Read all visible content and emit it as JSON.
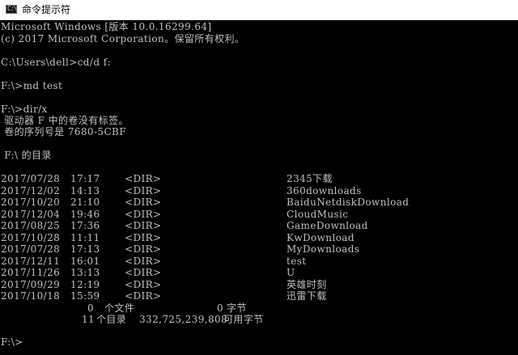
{
  "window": {
    "title": "命令提示符",
    "icon_label": "C:\\",
    "icon": "cmd-icon"
  },
  "console": {
    "header": {
      "line1": "Microsoft Windows [版本 10.0.16299.64]",
      "line2": "(c) 2017 Microsoft Corporation。保留所有权利。"
    },
    "commands": {
      "cd": "C:\\Users\\dell>cd/d f:",
      "md": "F:\\>md test",
      "dir": "F:\\>dir/x"
    },
    "volume": {
      "label_line": " 驱动器 F 中的卷没有标签。",
      "serial_line": " 卷的序列号是 7680-5CBF",
      "directory_of": " F:\\ 的目录"
    },
    "entries": [
      {
        "date": "2017/07/28",
        "time": "17:17",
        "type": "<DIR>",
        "name": "2345下载"
      },
      {
        "date": "2017/12/02",
        "time": "14:13",
        "type": "<DIR>",
        "name": "360downloads"
      },
      {
        "date": "2017/10/20",
        "time": "21:10",
        "type": "<DIR>",
        "name": "BaiduNetdiskDownload"
      },
      {
        "date": "2017/12/04",
        "time": "19:46",
        "type": "<DIR>",
        "name": "CloudMusic"
      },
      {
        "date": "2017/08/25",
        "time": "17:36",
        "type": "<DIR>",
        "name": "GameDownload"
      },
      {
        "date": "2017/10/28",
        "time": "11:11",
        "type": "<DIR>",
        "name": "KwDownload"
      },
      {
        "date": "2017/07/28",
        "time": "17:13",
        "type": "<DIR>",
        "name": "MyDownloads"
      },
      {
        "date": "2017/12/11",
        "time": "16:01",
        "type": "<DIR>",
        "name": "test"
      },
      {
        "date": "2017/11/26",
        "time": "13:13",
        "type": "<DIR>",
        "name": "U"
      },
      {
        "date": "2017/09/29",
        "time": "12:19",
        "type": "<DIR>",
        "name": "英雄时刻"
      },
      {
        "date": "2017/10/18",
        "time": "15:59",
        "type": "<DIR>",
        "name": "迅雷下载"
      }
    ],
    "summary": {
      "files_count": "0",
      "files_label": "个文件",
      "files_bytes": "0",
      "files_bytes_label": "字节",
      "dirs_count": "11",
      "dirs_label": "个目录",
      "dirs_free": "332,725,239,808",
      "dirs_free_label": "可用字节"
    },
    "prompt": "F:\\>"
  }
}
